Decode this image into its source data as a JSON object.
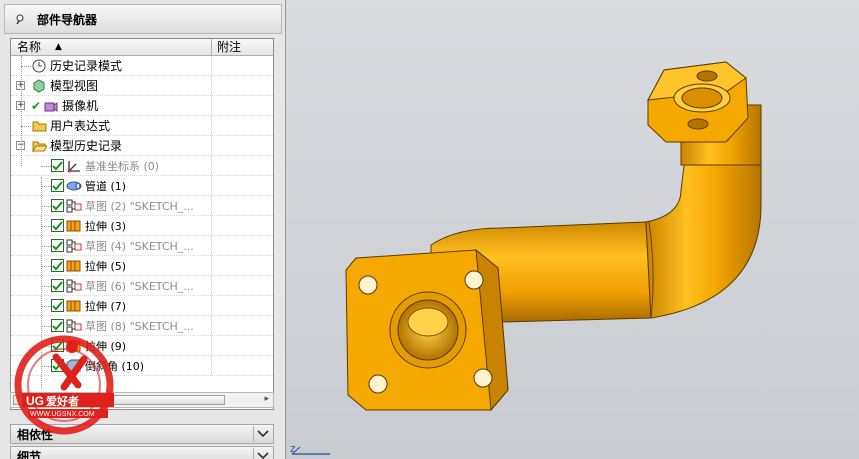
{
  "navigator": {
    "title": "部件导航器",
    "columns": {
      "name": "名称",
      "note": "附注"
    },
    "rows": [
      {
        "label": "历史记录模式",
        "icon": "clock-icon",
        "dim": false
      },
      {
        "label": "模型视图",
        "icon": "model-view-icon",
        "dim": false,
        "expand": "+"
      },
      {
        "label": "摄像机",
        "icon": "camera-icon",
        "dim": false,
        "expand": "+",
        "checkmark": true
      },
      {
        "label": "用户表达式",
        "icon": "folder-icon",
        "dim": false
      },
      {
        "label": "模型历史记录",
        "icon": "folder-open-icon",
        "dim": false,
        "expand": "−"
      },
      {
        "label": "基准坐标系 (0)",
        "icon": "datum-csys-icon",
        "dim": true
      },
      {
        "label": "管道 (1)",
        "icon": "tube-icon",
        "dim": false
      },
      {
        "label": "草图 (2) \"SKETCH_...",
        "icon": "sketch-icon",
        "dim": true
      },
      {
        "label": "拉伸 (3)",
        "icon": "extrude-icon",
        "dim": false
      },
      {
        "label": "草图 (4) \"SKETCH_...",
        "icon": "sketch-icon",
        "dim": true
      },
      {
        "label": "拉伸 (5)",
        "icon": "extrude-icon",
        "dim": false
      },
      {
        "label": "草图 (6) \"SKETCH_...",
        "icon": "sketch-icon",
        "dim": true
      },
      {
        "label": "拉伸 (7)",
        "icon": "extrude-icon",
        "dim": false
      },
      {
        "label": "草图 (8) \"SKETCH_...",
        "icon": "sketch-icon",
        "dim": true
      },
      {
        "label": "拉伸 (9)",
        "icon": "extrude-icon",
        "dim": false
      },
      {
        "label": "倒斜角 (10)",
        "icon": "chamfer-icon",
        "dim": false
      }
    ]
  },
  "panels": {
    "dependencies": "相依性",
    "details": "细节"
  },
  "watermark": {
    "text": "UG爱好者",
    "url": "WWW.UGSNX.COM"
  },
  "colors": {
    "part_body": "#f5a800",
    "part_shadow": "#c77f00",
    "part_highlight": "#ffd24a",
    "viewport_bg": "#cdd0d4"
  }
}
